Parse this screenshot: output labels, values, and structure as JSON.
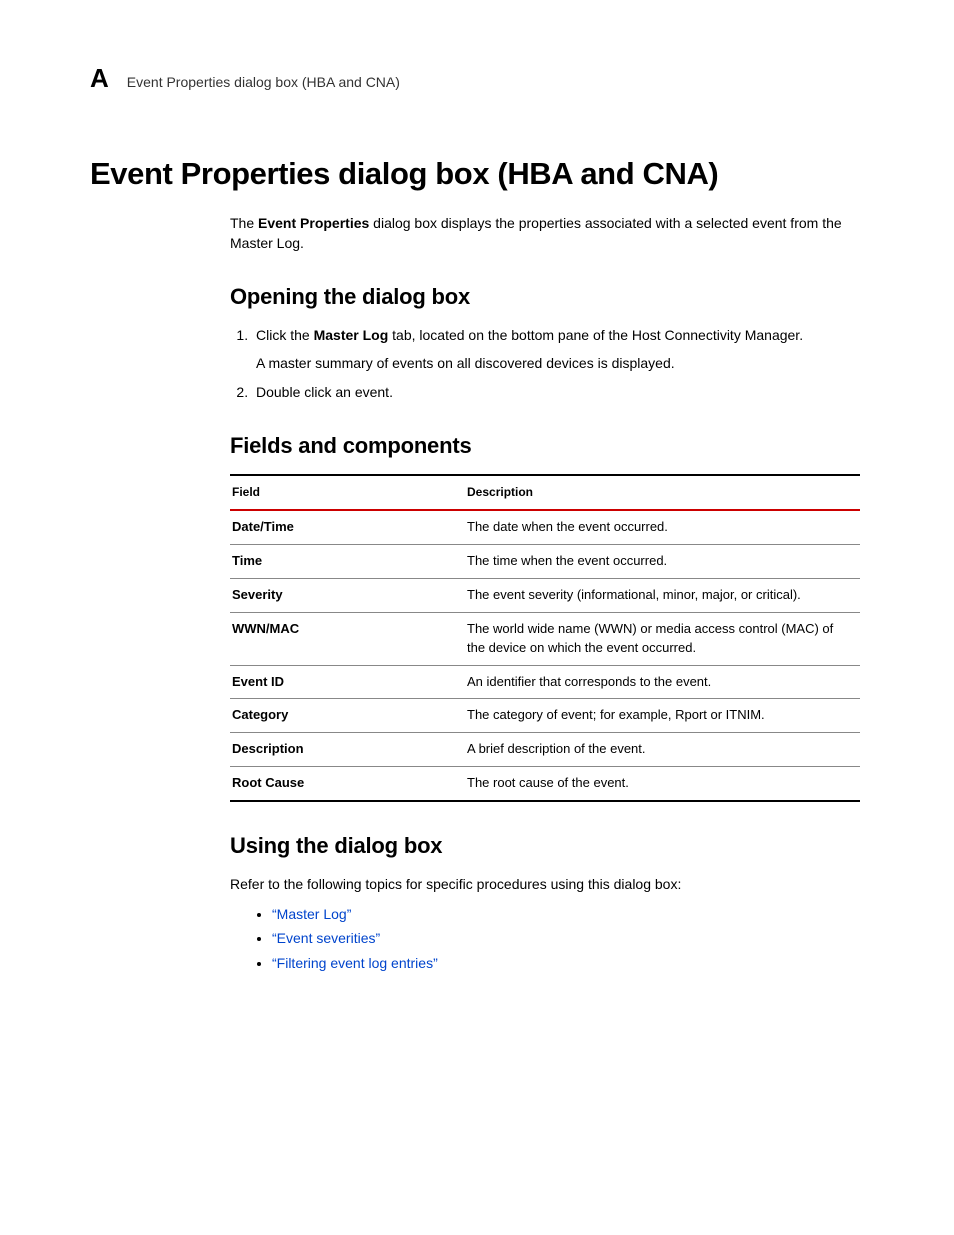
{
  "header": {
    "appendix_letter": "A",
    "running_title": "Event Properties dialog box (HBA and CNA)"
  },
  "title": "Event Properties dialog box (HBA and CNA)",
  "intro": {
    "prefix": "The ",
    "bold": "Event Properties",
    "suffix": " dialog box displays the properties associated with a selected event from the Master Log."
  },
  "section_opening": {
    "heading": "Opening the dialog box",
    "steps": [
      {
        "prefix": "Click the ",
        "bold": "Master Log",
        "suffix": " tab, located on the bottom pane of the Host Connectivity Manager.",
        "sub": "A master summary of events on all discovered devices is displayed."
      },
      {
        "text": "Double click an event."
      }
    ]
  },
  "section_fields": {
    "heading": "Fields and components",
    "col_field": "Field",
    "col_desc": "Description",
    "rows": [
      {
        "field": "Date/Time",
        "desc": "The date when the event occurred."
      },
      {
        "field": "Time",
        "desc": "The time when the event occurred."
      },
      {
        "field": "Severity",
        "desc": "The event severity (informational, minor, major, or critical)."
      },
      {
        "field": "WWN/MAC",
        "desc": "The world wide name (WWN) or media access control (MAC) of the device on which the event occurred."
      },
      {
        "field": "Event ID",
        "desc": "An identifier that corresponds to the event."
      },
      {
        "field": "Category",
        "desc": "The category of event; for example, Rport or ITNIM."
      },
      {
        "field": "Description",
        "desc": "A brief description of the event."
      },
      {
        "field": "Root Cause",
        "desc": "The root cause of the event."
      }
    ]
  },
  "section_using": {
    "heading": "Using the dialog box",
    "intro": "Refer to the following topics for specific procedures using this dialog box:",
    "links": [
      "“Master Log”",
      "“Event severities”",
      "“Filtering event log entries”"
    ]
  }
}
